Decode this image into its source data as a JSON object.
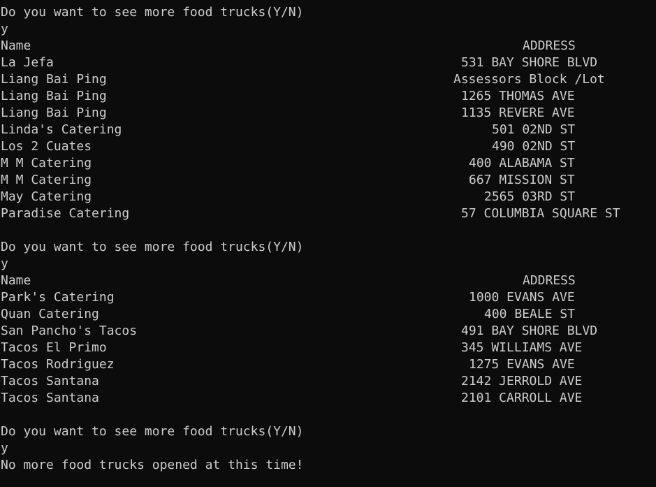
{
  "prompt_text": "Do you want to see more food trucks(Y/N)",
  "user_input": "y",
  "header": {
    "name": "Name",
    "address": "ADDRESS"
  },
  "batch1": [
    {
      "name": "La Jefa",
      "address": "531 BAY SHORE BLVD"
    },
    {
      "name": "Liang Bai Ping",
      "address": "Assessors Block /Lot"
    },
    {
      "name": "Liang Bai Ping",
      "address": "1265 THOMAS AVE"
    },
    {
      "name": "Liang Bai Ping",
      "address": "1135 REVERE AVE"
    },
    {
      "name": "Linda's Catering",
      "address": "501 02ND ST"
    },
    {
      "name": "Los 2 Cuates",
      "address": "490 02ND ST"
    },
    {
      "name": "M M Catering",
      "address": "400 ALABAMA ST"
    },
    {
      "name": "M M Catering",
      "address": "667 MISSION ST"
    },
    {
      "name": "May Catering",
      "address": "2565 03RD ST"
    },
    {
      "name": "Paradise Catering",
      "address": "57 COLUMBIA SQUARE ST"
    }
  ],
  "batch2": [
    {
      "name": "Park's Catering",
      "address": "1000 EVANS AVE"
    },
    {
      "name": "Quan Catering",
      "address": "400 BEALE ST"
    },
    {
      "name": "San Pancho's Tacos",
      "address": "491 BAY SHORE BLVD"
    },
    {
      "name": "Tacos El Primo",
      "address": "345 WILLIAMS AVE"
    },
    {
      "name": "Tacos Rodriguez",
      "address": "1275 EVANS AVE"
    },
    {
      "name": "Tacos Santana",
      "address": "2142 JERROLD AVE"
    },
    {
      "name": "Tacos Santana",
      "address": "2101 CARROLL AVE"
    }
  ],
  "final_message": "No more food trucks opened at this time!"
}
